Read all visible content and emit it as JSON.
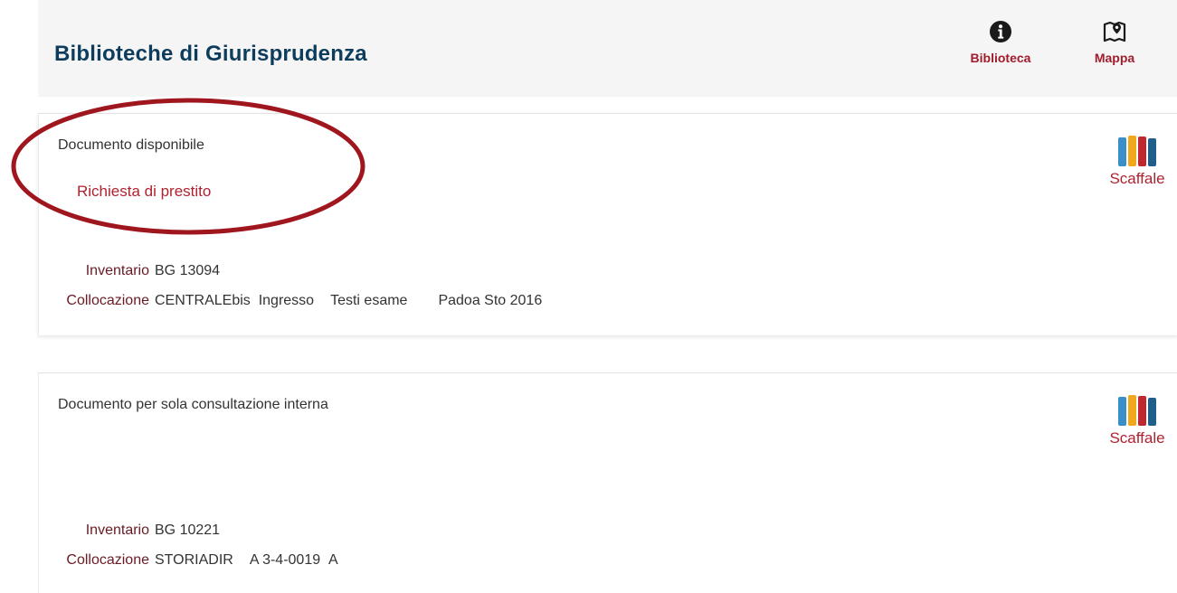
{
  "header": {
    "title": "Biblioteche di Giurisprudenza",
    "actions": [
      {
        "label": "Biblioteca",
        "icon": "info-circle-icon"
      },
      {
        "label": "Mappa",
        "icon": "map-pin-icon"
      }
    ]
  },
  "items": [
    {
      "status": "Documento disponibile",
      "loan_link": "Richiesta di prestito",
      "shelf_label": "Scaffale",
      "inventory_label": "Inventario",
      "inventory_value": "BG 13094",
      "location_label": "Collocazione",
      "location_parts": [
        "CENTRALEbis",
        "Ingresso",
        "Testi esame",
        "Padoa Sto 2016"
      ]
    },
    {
      "status": "Documento per sola consultazione interna",
      "shelf_label": "Scaffale",
      "inventory_label": "Inventario",
      "inventory_value": "BG 10221",
      "location_label": "Collocazione",
      "location_parts": [
        "STORIADIR",
        "A 3-4-0019",
        "A"
      ]
    }
  ],
  "colors": {
    "title": "#0d3c5c",
    "accent": "#b0222f",
    "label": "#6b1a22",
    "annotation": "#a0161e",
    "header_bg": "#f5f5f5"
  }
}
